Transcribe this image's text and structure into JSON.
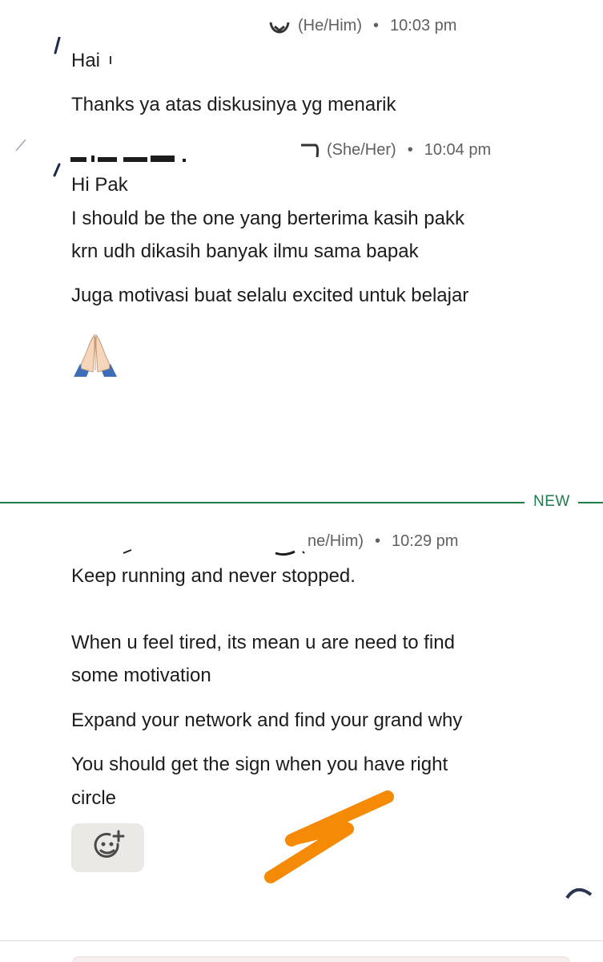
{
  "messages": [
    {
      "pronouns": "(He/Him)",
      "time": "10:03 pm",
      "lines": [
        "Hai",
        "Thanks ya atas diskusinya yg menarik"
      ]
    },
    {
      "pronouns": "(She/Her)",
      "time": "10:04 pm",
      "lines": [
        "Hi Pak",
        "I should be the one yang berterima kasih pakk",
        "krn udh dikasih banyak ilmu sama bapak",
        "Juga motivasi buat selalu excited untuk belajar"
      ],
      "emoji": "🙏🏻"
    },
    {
      "pronouns": "ne/Him)",
      "time": "10:29 pm",
      "lines": [
        "Keep running and never stopped.",
        "When u feel tired, its mean u are need to find",
        "some motivation",
        "Expand your network and find your grand why",
        "You should get the sign when you have right",
        "circle"
      ]
    }
  ],
  "divider": {
    "label": "NEW"
  },
  "colors": {
    "accent_green": "#1e7d4b",
    "text": "#1d1c1d",
    "meta": "#616061",
    "scribble": "#f58a07"
  },
  "icons": {
    "reaction": "add-reaction-icon"
  }
}
